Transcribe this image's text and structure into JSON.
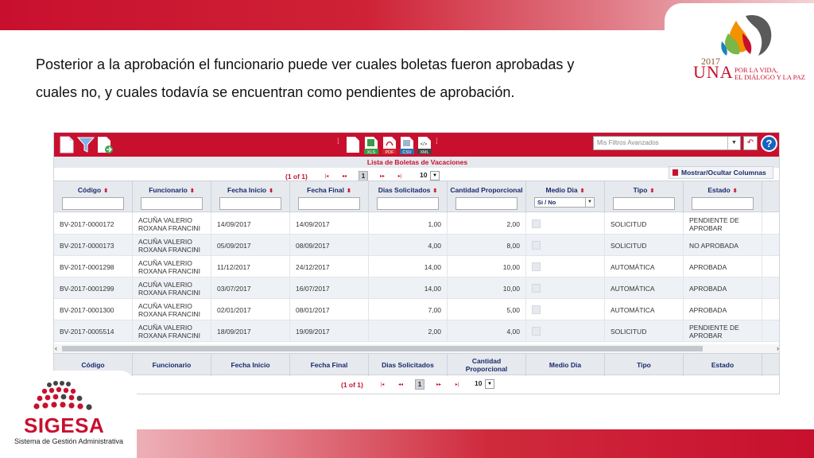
{
  "caption": {
    "line1": "Posterior a la aprobación el funcionario puede ver cuales boletas fueron aprobadas y",
    "line2": "cuales no, y cuales todavía se encuentran como pendientes de aprobación."
  },
  "una_logo": {
    "year": "2017",
    "word": "UNA",
    "tagline1": "POR LA VIDA,",
    "tagline2": "EL DIÁLOGO Y LA PAZ"
  },
  "sigesa_logo": {
    "title": "SIGESA",
    "subtitle": "Sistema de Gestión Administrativa"
  },
  "toolbar": {
    "icons": [
      "new-document-icon",
      "filter-icon",
      "export-document-icon",
      "blank-document-icon",
      "xls-icon",
      "pdf-icon",
      "csv-icon",
      "xml-icon"
    ],
    "export_labels": {
      "xls": "XLS",
      "pdf": "PDF",
      "csv": "CSV",
      "xml": "XML"
    },
    "filters_placeholder": "Mis Filtros Avanzados",
    "help_label": "?"
  },
  "list_title": "Lista de Boletas de Vacaciones",
  "pager": {
    "count": "(1 of 1)",
    "page": "1",
    "rows_per_page": "10",
    "first": "|◂",
    "prev": "◂◂",
    "next": "▸▸",
    "last": "▸|"
  },
  "toggle_columns_label": "Mostrar/Ocultar Columnas",
  "columns": [
    "Código",
    "Funcionario",
    "Fecha Inicio",
    "Fecha Final",
    "Dias Solicitados",
    "Cantidad Proporcional",
    "Medio Dia",
    "Tipo",
    "Estado"
  ],
  "footer_columns": [
    "Código",
    "Funcionario",
    "Fecha Inicio",
    "Fecha Final",
    "Dias Solicitados",
    "Cantidad Proporcional",
    "Medio Dia",
    "Tipo",
    "Estado"
  ],
  "medio_dia_filter": "Si / No",
  "rows": [
    {
      "codigo": "BV-2017-0000172",
      "funcionario": "ACUÑA VALERIO ROXANA FRANCINI",
      "inicio": "14/09/2017",
      "final": "14/09/2017",
      "dias": "1,00",
      "proporcional": "2,00",
      "tipo": "SOLICITUD",
      "estado": "PENDIENTE DE APROBAR"
    },
    {
      "codigo": "BV-2017-0000173",
      "funcionario": "ACUÑA VALERIO ROXANA FRANCINI",
      "inicio": "05/09/2017",
      "final": "08/09/2017",
      "dias": "4,00",
      "proporcional": "8,00",
      "tipo": "SOLICITUD",
      "estado": "NO APROBADA"
    },
    {
      "codigo": "BV-2017-0001298",
      "funcionario": "ACUÑA VALERIO ROXANA FRANCINI",
      "inicio": "11/12/2017",
      "final": "24/12/2017",
      "dias": "14,00",
      "proporcional": "10,00",
      "tipo": "AUTOMÁTICA",
      "estado": "APROBADA"
    },
    {
      "codigo": "BV-2017-0001299",
      "funcionario": "ACUÑA VALERIO ROXANA FRANCINI",
      "inicio": "03/07/2017",
      "final": "16/07/2017",
      "dias": "14,00",
      "proporcional": "10,00",
      "tipo": "AUTOMÁTICA",
      "estado": "APROBADA"
    },
    {
      "codigo": "BV-2017-0001300",
      "funcionario": "ACUÑA VALERIO ROXANA FRANCINI",
      "inicio": "02/01/2017",
      "final": "08/01/2017",
      "dias": "7,00",
      "proporcional": "5,00",
      "tipo": "AUTOMÁTICA",
      "estado": "APROBADA"
    },
    {
      "codigo": "BV-2017-0005514",
      "funcionario": "ACUÑA VALERIO ROXANA FRANCINI",
      "inicio": "18/09/2017",
      "final": "19/09/2017",
      "dias": "2,00",
      "proporcional": "4,00",
      "tipo": "SOLICITUD",
      "estado": "PENDIENTE DE APROBAR"
    }
  ],
  "colors": {
    "brand_red": "#c8102e",
    "header_text": "#1a2a6a",
    "row_alt": "#eef1f5"
  }
}
